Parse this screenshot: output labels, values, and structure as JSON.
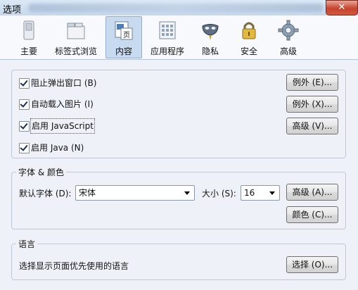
{
  "window": {
    "title": "选项"
  },
  "toolbar": {
    "tabs": [
      {
        "label": "主要",
        "icon": "main-switch-icon"
      },
      {
        "label": "标签式浏览",
        "icon": "tabs-icon"
      },
      {
        "label": "内容",
        "icon": "content-page-icon",
        "selected": true
      },
      {
        "label": "应用程序",
        "icon": "applications-icon"
      },
      {
        "label": "隐私",
        "icon": "privacy-mask-icon"
      },
      {
        "label": "安全",
        "icon": "lock-icon"
      },
      {
        "label": "高级",
        "icon": "gear-icon"
      }
    ]
  },
  "content": {
    "options": [
      {
        "label": "阻止弹出窗口",
        "key": "(B)",
        "checked": true,
        "button": "例外 (E)..."
      },
      {
        "label": "自动载入图片",
        "key": "(I)",
        "checked": true,
        "button": "例外 (X)..."
      },
      {
        "label": "启用 JavaScript",
        "key": "",
        "checked": true,
        "button": "高级 (V)..."
      },
      {
        "label": "启用 Java",
        "key": "(N)",
        "checked": true,
        "button": ""
      }
    ],
    "fonts": {
      "legend": "字体 & 颜色",
      "default_font_label": "默认字体 (D):",
      "default_font_value": "宋体",
      "size_label": "大小 (S):",
      "size_value": "16",
      "advanced_button": "高级 (A)...",
      "colors_button": "颜色 (C)..."
    },
    "languages": {
      "legend": "语言",
      "description": "选择显示页面优先使用的语言",
      "choose_button": "选择 (O)..."
    }
  },
  "colors": {
    "selected_tab": "#c8daf0",
    "close_button": "#c7432e"
  }
}
